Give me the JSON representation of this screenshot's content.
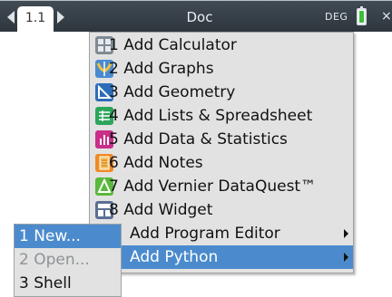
{
  "header": {
    "page_tab": "1.1",
    "title": "Doc",
    "mode": "DEG"
  },
  "menu": {
    "items": [
      {
        "num": "1",
        "label": "Add Calculator",
        "icon": "calculator-icon",
        "color": "#7f8a93"
      },
      {
        "num": "2",
        "label": "Add Graphs",
        "icon": "graphs-icon",
        "color": "#4a8bd0"
      },
      {
        "num": "3",
        "label": "Add Geometry",
        "icon": "geometry-icon",
        "color": "#2c6db8"
      },
      {
        "num": "4",
        "label": "Add Lists & Spreadsheet",
        "icon": "spreadsheet-icon",
        "color": "#2ba55b"
      },
      {
        "num": "5",
        "label": "Add Data & Statistics",
        "icon": "data-statistics-icon",
        "color": "#c92f8a"
      },
      {
        "num": "6",
        "label": "Add Notes",
        "icon": "notes-icon",
        "color": "#f08a24"
      },
      {
        "num": "7",
        "label": "Add Vernier DataQuest™",
        "icon": "dataquest-icon",
        "color": "#5ab83c"
      },
      {
        "num": "8",
        "label": "Add Widget",
        "icon": "widget-icon",
        "color": "#5a6f93"
      },
      {
        "num": "",
        "label": "Add Program Editor",
        "icon": "",
        "color": ""
      },
      {
        "num": "",
        "label": "Add Python",
        "icon": "",
        "color": ""
      }
    ]
  },
  "submenu": {
    "items": [
      {
        "label": "1 New...",
        "state": "selected"
      },
      {
        "label": "2 Open...",
        "state": "disabled"
      },
      {
        "label": "3 Shell",
        "state": "normal"
      }
    ]
  },
  "colors": {
    "highlight": "#4b8bcd",
    "menu_bg": "#e2e2e2",
    "titlebar": "#38414a",
    "battery": "#3bbf3b"
  }
}
